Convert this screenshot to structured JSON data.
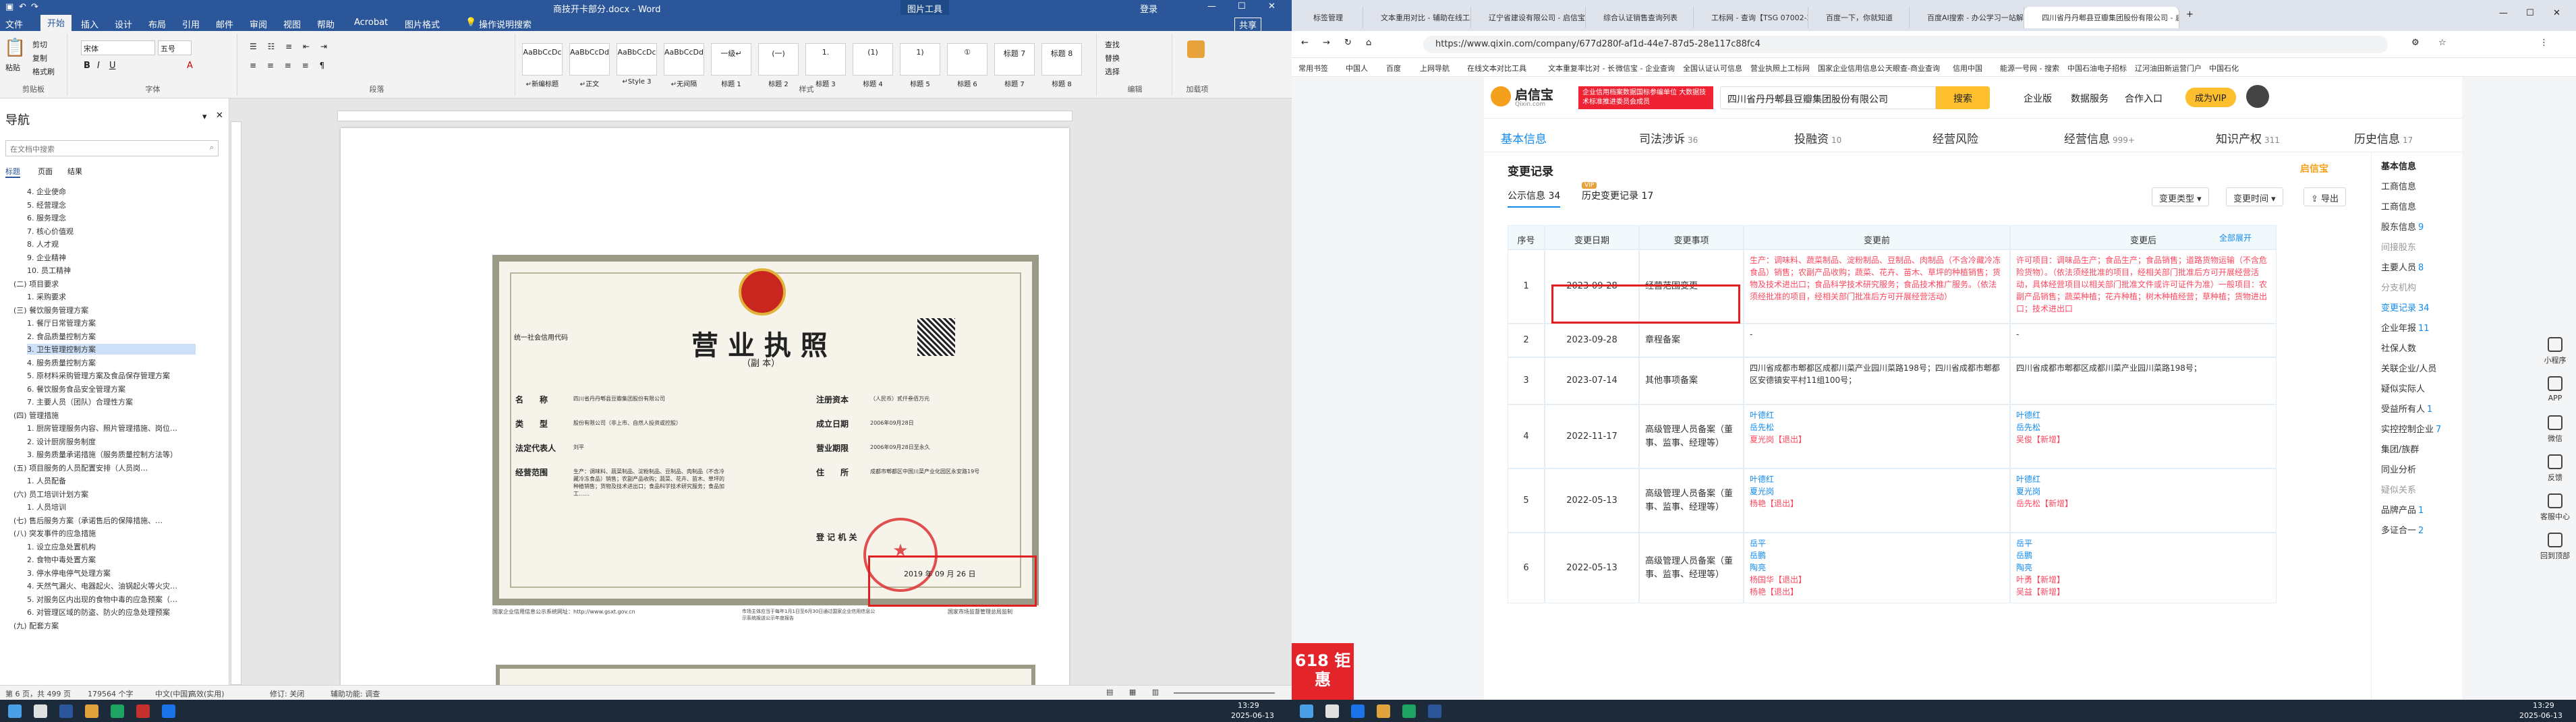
{
  "word": {
    "title": "商技开卡部分.docx - Word",
    "picture_tools": "图片工具",
    "login": "登录",
    "share": "共享",
    "tabs": [
      "文件",
      "开始",
      "插入",
      "设计",
      "布局",
      "引用",
      "邮件",
      "审阅",
      "视图",
      "帮助",
      "Acrobat",
      "图片格式",
      "操作说明搜索"
    ],
    "active_tab": "开始",
    "clipboard": {
      "paste": "粘贴",
      "cut": "剪切",
      "copy": "复制",
      "painter": "格式刷",
      "label": "剪贴板"
    },
    "font": {
      "name": "宋体",
      "size": "五号",
      "label": "字体"
    },
    "paragraph_label": "段落",
    "styles": [
      {
        "preview": "AaBbCcDc",
        "name": "↵新编标题"
      },
      {
        "preview": "AaBbCcDd",
        "name": "↵正文"
      },
      {
        "preview": "AaBbCcDc",
        "name": "↵Style 3"
      },
      {
        "preview": "AaBbCcDd",
        "name": "↵无间隔"
      },
      {
        "preview": "一级↵",
        "name": "标题 1"
      },
      {
        "preview": "(一)",
        "name": "标题 2"
      },
      {
        "preview": "1.",
        "name": "标题 3"
      },
      {
        "preview": "(1)",
        "name": "标题 4"
      },
      {
        "preview": "1)",
        "name": "标题 5"
      },
      {
        "preview": "①",
        "name": "标题 6"
      },
      {
        "preview": "标题 7",
        "name": "标题 7"
      },
      {
        "preview": "标题 8",
        "name": "标题 8"
      }
    ],
    "styles_label": "样式",
    "editing": {
      "find": "查找",
      "replace": "替换",
      "select": "选择",
      "label": "编辑"
    },
    "acrobat": "加载项",
    "nav": {
      "title": "导航",
      "search_placeholder": "在文档中搜索",
      "tabs": [
        "标题",
        "页面",
        "结果"
      ]
    },
    "nav_items": [
      "4. 企业使命",
      "5. 经营理念",
      "6. 服务理念",
      "7. 核心价值观",
      "8. 人才观",
      "9. 企业精神",
      "10. 员工精神",
      "(二) 项目要求",
      "1. 采购要求",
      "(三) 餐饮服务管理方案",
      "1. 餐厅日常管理方案",
      "2. 食品质量控制方案",
      "3. 卫生管理控制方案",
      "4. 服务质量控制方案",
      "5. 原材料采购管理方案及食品保存管理方案",
      "6. 餐饮服务食品安全管理方案",
      "7. 主要人员（团队）合理性方案",
      "(四) 管理措施",
      "1. 厨房管理服务内容、照片管理措施、岗位…",
      "2. 设计厨房服务制度",
      "3. 服务质量承诺措施（服务质量控制方法等）",
      "(五) 项目服务的人员配置安排（人员岗…",
      "1. 人员配备",
      "(六) 员工培训计划方案",
      "1. 人员培训",
      "(七) 售后服务方案（承诺售后的保障措施、…",
      "(八) 突发事件的应急措施",
      "1. 设立应急处置机构",
      "2. 食物中毒处置方案",
      "3. 停水停电停气处理方案",
      "4. 天然气漏火、电器起火、油锅起火等火灾…",
      "5. 对服务区内出现的食物中毒的应急预案（…",
      "6. 对管理区域的防盗、防火的应急处理预案",
      "(九) 配套方案"
    ],
    "status": {
      "page": "第 6 页，共 499 页",
      "words": "179564 个字",
      "lang": "中文(中国)",
      "mode": "高效(实用)",
      "track": "修订: 关闭",
      "access": "辅助功能: 调查"
    },
    "license": {
      "title": "营 业 执 照",
      "subtitle": "（副 本）",
      "credit_label": "统一社会信用代码",
      "fields": [
        {
          "label": "名　　称",
          "value": "四川省丹丹郫县豆瓣集团股份有限公司"
        },
        {
          "label": "类　　型",
          "value": "股份有限公司（非上市、自然人投资或控股）"
        },
        {
          "label": "法定代表人",
          "value": "刘平"
        },
        {
          "label": "经营范围",
          "value": "生产：调味料、蔬菜制品、淀粉制品、豆制品、肉制品（不含冷藏冷冻食品）销售；农副产品收购；蔬菜、花卉、苗木、草坪的种植销售；货物及技术进出口；食品科学技术研究服务；食品加工……"
        }
      ],
      "right_fields": [
        {
          "label": "注册资本",
          "value": "（人民币）贰仟叁佰万元"
        },
        {
          "label": "成立日期",
          "value": "2006年09月28日"
        },
        {
          "label": "营业期限",
          "value": "2006年09月28日至永久"
        },
        {
          "label": "住　　所",
          "value": "成都市郫都区中国川菜产业化园区永安路19号"
        }
      ],
      "reg_org": "登 记 机 关",
      "date": "2019 年 09 月 26 日",
      "footer_left": "国家企业信用信息公示系统网址：http://www.gsxt.gov.cn",
      "footer_mid": "市场主体应当于每年1月1日至6月30日通过国家企业信用信息公示系统报送公示年度报告",
      "footer_right": "国家市场监督管理总局监制"
    }
  },
  "browser": {
    "tabs": [
      "标签管理",
      "文本重用对比 - 辅助在线工具",
      "辽宁省建设有限公司 - 启信宝",
      "综合认证销售查询列表",
      "工标网 - 查询【TSG 07002-20…",
      "百度一下，你就知道",
      "百度AI搜索 - 办公学习一站解决",
      "四川省丹丹郫县豆瓣集团股份有限公司 - 启信宝"
    ],
    "url": "https://www.qixin.com/company/677d280f-af1d-44e7-87d5-28e117c88fc4",
    "bookmarks": [
      "常用书签",
      "中国人",
      "百度",
      "上网导航",
      "在线文本对比工具",
      "文本重复率比对 - 长",
      "微信宝 - 企业查询",
      "全国认证认可信息",
      "营业执照上工标网",
      "国家企业信用信息公",
      "天眼查-商业查询",
      "信用中国",
      "能源一号网 - 搜索",
      "中国石油电子招标",
      "辽河油田新运营门户",
      "中国石化"
    ]
  },
  "qixin": {
    "logo": "启信宝",
    "logo_sub": "Qixin.com",
    "promo": "企业信用档案数据国标参编单位 大数据技术标准推进委员会成员",
    "search_value": "四川省丹丹郫县豆瓣集团股份有限公司",
    "search_btn": "搜索",
    "menus": [
      "企业版",
      "数据服务",
      "合作入口"
    ],
    "vip": "成为VIP",
    "tabs": [
      {
        "t": "基本信息",
        "n": ""
      },
      {
        "t": "司法涉诉",
        "n": "36"
      },
      {
        "t": "投融资",
        "n": "10"
      },
      {
        "t": "经营风险",
        "n": ""
      },
      {
        "t": "经营信息",
        "n": "999+"
      },
      {
        "t": "知识产权",
        "n": "311"
      },
      {
        "t": "历史信息",
        "n": "17"
      }
    ],
    "section": "变更记录",
    "subtabs": [
      "公示信息 34",
      "历史变更记录 17"
    ],
    "vip_badge": "VIP",
    "filters": [
      "变更类型",
      "变更时间",
      "导出"
    ],
    "headers": [
      "序号",
      "变更日期",
      "变更事项",
      "变更前",
      "变更后"
    ],
    "expand": "全部展开",
    "rows": [
      {
        "no": "1",
        "date": "2023-09-28",
        "item": "经营范围变更",
        "before": "生产：调味料、蔬菜制品、淀粉制品、豆制品、肉制品（不含冷藏冷冻食品）销售；农副产品收购；蔬菜、花卉、苗木、草坪的种植销售；货物及技术进出口；食品科学技术研究服务；食品技术推广服务。（依法须经批准的项目，经相关部门批准后方可开展经营活动）",
        "after": "许可项目：调味品生产；食品生产；食品销售；道路货物运输（不含危险货物）。（依法须经批准的项目，经相关部门批准后方可开展经营活动，具体经营项目以相关部门批准文件或许可证件为准）一般项目：农副产品销售；蔬菜种植；花卉种植；树木种植经营；草种植；货物进出口；技术进出口"
      },
      {
        "no": "2",
        "date": "2023-09-28",
        "item": "章程备案",
        "before": "-",
        "after": "-"
      },
      {
        "no": "3",
        "date": "2023-07-14",
        "item": "其他事项备案",
        "before": "四川省成都市郫都区成都川菜产业园川菜路198号；四川省成都市郫都区安德镇安平村11组100号；",
        "after": "四川省成都市郫都区成都川菜产业园川菜路198号；"
      },
      {
        "no": "4",
        "date": "2022-11-17",
        "item": "高级管理人员备案（董事、监事、经理等）",
        "before": [
          "叶德红",
          "岳先松",
          "夏光岗【退出】"
        ],
        "after": [
          "叶德红",
          "岳先松",
          "吴俊【新增】"
        ]
      },
      {
        "no": "5",
        "date": "2022-05-13",
        "item": "高级管理人员备案（董事、监事、经理等）",
        "before": [
          "叶德红",
          "夏光岗",
          "杨艳【退出】"
        ],
        "after": [
          "叶德红",
          "夏光岗",
          "岳先松【新增】"
        ]
      },
      {
        "no": "6",
        "date": "2022-05-13",
        "item": "高级管理人员备案（董事、监事、经理等）",
        "before": [
          "岳平",
          "岳鹏",
          "陶亮",
          "杨国华【退出】",
          "杨艳【退出】"
        ],
        "after": [
          "岳平",
          "岳鹏",
          "陶亮",
          "叶勇【新增】",
          "吴益【新增】"
        ]
      }
    ],
    "sidebar_title": "基本信息",
    "sidebar": [
      {
        "t": "工商信息",
        "c": "",
        "g": false
      },
      {
        "t": "工商信息",
        "c": "",
        "g": false
      },
      {
        "t": "股东信息",
        "c": "9",
        "g": false
      },
      {
        "t": "间接股东",
        "c": "",
        "g": true
      },
      {
        "t": "主要人员",
        "c": "8",
        "g": false
      },
      {
        "t": "分支机构",
        "c": "",
        "g": true
      },
      {
        "t": "变更记录",
        "c": "34",
        "g": false
      },
      {
        "t": "企业年报",
        "c": "11",
        "g": false
      },
      {
        "t": "社保人数",
        "c": "",
        "g": false
      },
      {
        "t": "关联企业/人员",
        "c": "",
        "g": false
      },
      {
        "t": "疑似实际人",
        "c": "",
        "g": false
      },
      {
        "t": "受益所有人",
        "c": "1",
        "g": false
      },
      {
        "t": "实控控制企业",
        "c": "7",
        "g": false
      },
      {
        "t": "集团/族群",
        "c": "",
        "g": false
      },
      {
        "t": "同业分析",
        "c": "",
        "g": false
      },
      {
        "t": "疑似关系",
        "c": "",
        "g": true
      },
      {
        "t": "品牌产品",
        "c": "1",
        "g": false
      },
      {
        "t": "多证合一",
        "c": "2",
        "g": false
      }
    ],
    "right_tools": [
      "小程序",
      "APP",
      "微信",
      "反馈",
      "客服中心",
      "回到顶部"
    ],
    "promo618": "618 钜惠"
  },
  "taskbar": {
    "time": "13:29",
    "date": "2025-06-13",
    "time2": "13:29",
    "date2": "2025-06-13"
  },
  "colors": {
    "word_blue": "#2b579a",
    "qixin_blue": "#128bed",
    "highlight_red": "#e02020",
    "change_red": "#fd485e"
  }
}
